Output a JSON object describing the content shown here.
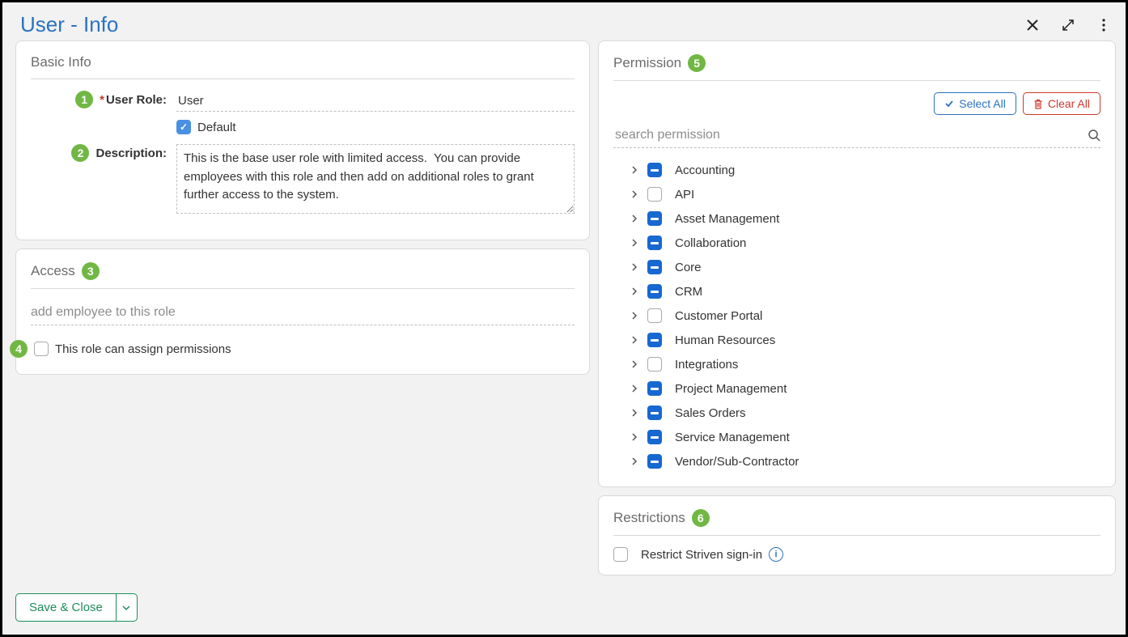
{
  "page": {
    "title": "User - Info"
  },
  "sections": {
    "basic_info": {
      "title": "Basic Info",
      "user_role_label": "User Role:",
      "user_role_value": "User",
      "user_role_badge": "1",
      "default_label": "Default",
      "description_label": "Description:",
      "description_badge": "2",
      "description_value": "This is the base user role with limited access.  You can provide employees with this role and then add on additional roles to grant further access to the system."
    },
    "access": {
      "title": "Access",
      "title_badge": "3",
      "add_placeholder": "add employee to this role",
      "assign_badge": "4",
      "assign_label": "This role can assign permissions"
    },
    "permission": {
      "title": "Permission",
      "title_badge": "5",
      "select_all": "Select All",
      "clear_all": "Clear All",
      "search_placeholder": "search permission",
      "items": [
        {
          "label": "Accounting",
          "state": "indeterminate"
        },
        {
          "label": "API",
          "state": "empty"
        },
        {
          "label": "Asset Management",
          "state": "indeterminate"
        },
        {
          "label": "Collaboration",
          "state": "indeterminate"
        },
        {
          "label": "Core",
          "state": "indeterminate"
        },
        {
          "label": "CRM",
          "state": "indeterminate"
        },
        {
          "label": "Customer Portal",
          "state": "empty"
        },
        {
          "label": "Human Resources",
          "state": "indeterminate"
        },
        {
          "label": "Integrations",
          "state": "empty"
        },
        {
          "label": "Project Management",
          "state": "indeterminate"
        },
        {
          "label": "Sales Orders",
          "state": "indeterminate"
        },
        {
          "label": "Service Management",
          "state": "indeterminate"
        },
        {
          "label": "Vendor/Sub-Contractor",
          "state": "indeterminate"
        }
      ]
    },
    "restrictions": {
      "title": "Restrictions",
      "title_badge": "6",
      "restrict_label": "Restrict Striven sign-in"
    }
  },
  "footer": {
    "save_close": "Save & Close"
  }
}
